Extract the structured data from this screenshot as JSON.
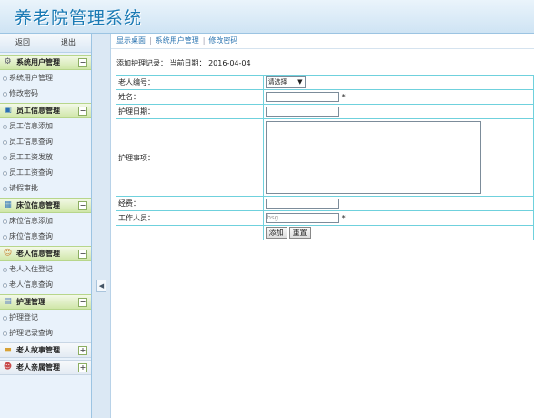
{
  "app": {
    "title": "养老院管理系统"
  },
  "sidebar": {
    "back": "返回",
    "exit": "退出",
    "sections": [
      {
        "title": "系统用户管理",
        "icon": "gear-icon",
        "toggle": "−",
        "items": [
          "系统用户管理",
          "修改密码"
        ]
      },
      {
        "title": "员工信息管理",
        "icon": "monitor-icon",
        "toggle": "−",
        "items": [
          "员工信息添加",
          "员工信息查询",
          "员工工资发放",
          "员工工资查询",
          "请假审批"
        ]
      },
      {
        "title": "床位信息管理",
        "icon": "calendar-icon",
        "toggle": "−",
        "items": [
          "床位信息添加",
          "床位信息查询"
        ]
      },
      {
        "title": "老人信息管理",
        "icon": "user-icon",
        "toggle": "−",
        "items": [
          "老人入住登记",
          "老人信息查询"
        ]
      },
      {
        "title": "护理管理",
        "icon": "notepad-icon",
        "toggle": "−",
        "items": [
          "护理登记",
          "护理记录查询"
        ]
      },
      {
        "title": "老人故事管理",
        "icon": "folder-icon",
        "toggle": "+",
        "items": []
      },
      {
        "title": "老人亲属管理",
        "icon": "family-icon",
        "toggle": "+",
        "items": []
      }
    ]
  },
  "splitter": {
    "arrow": "◀"
  },
  "breadcrumb": [
    "显示桌面",
    "系统用户管理",
    "修改密码"
  ],
  "record": {
    "label": "添加护理记录：",
    "date_label": "当前日期：",
    "date": "2016-04-04"
  },
  "form": {
    "elder_label": "老人编号：",
    "elder_select": "请选择",
    "name_label": "姓名：",
    "date_label": "护理日期：",
    "matter_label": "护理事项：",
    "cost_label": "经费：",
    "worker_label": "工作人员：",
    "worker_value": "hsg",
    "required_mark": "*",
    "add_button": "添加",
    "reset_button": "重置"
  }
}
